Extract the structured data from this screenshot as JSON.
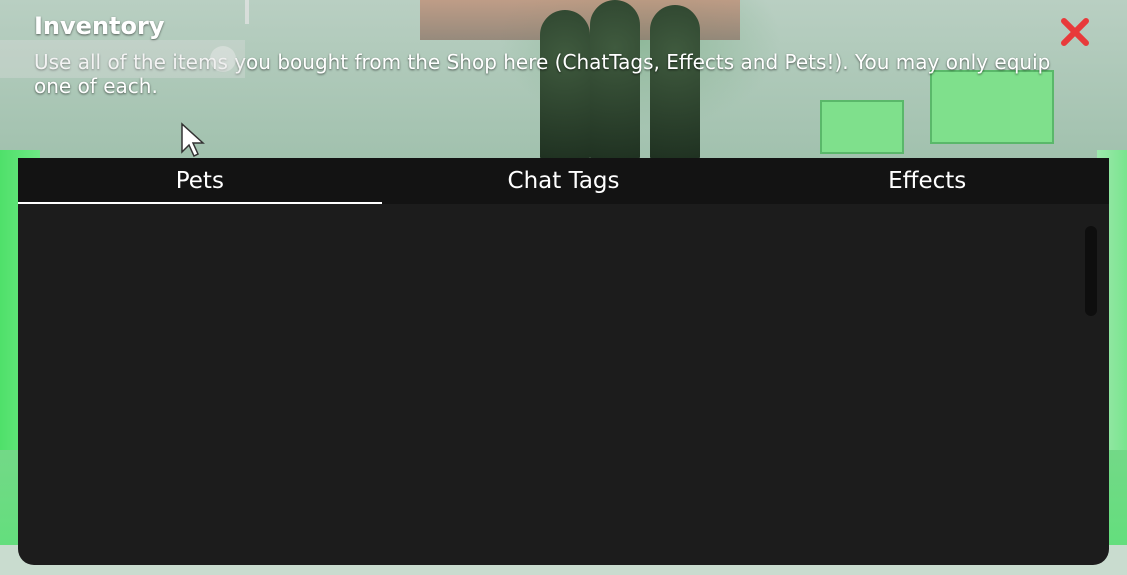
{
  "window": {
    "title": "Inventory",
    "description": "Use all of the items you bought from the Shop here (ChatTags, Effects and Pets!). You may only equip one of each."
  },
  "tabs": [
    {
      "label": "Pets",
      "active": true
    },
    {
      "label": "Chat Tags",
      "active": false
    },
    {
      "label": "Effects",
      "active": false
    }
  ],
  "icons": {
    "close": "close-x-icon",
    "chat": "chat-icon",
    "cursor": "mouse-cursor-icon"
  },
  "colors": {
    "close": "#e83a3a",
    "tab_bar": "#131313",
    "content_bg": "#1c1c1c",
    "text": "#ffffff"
  }
}
